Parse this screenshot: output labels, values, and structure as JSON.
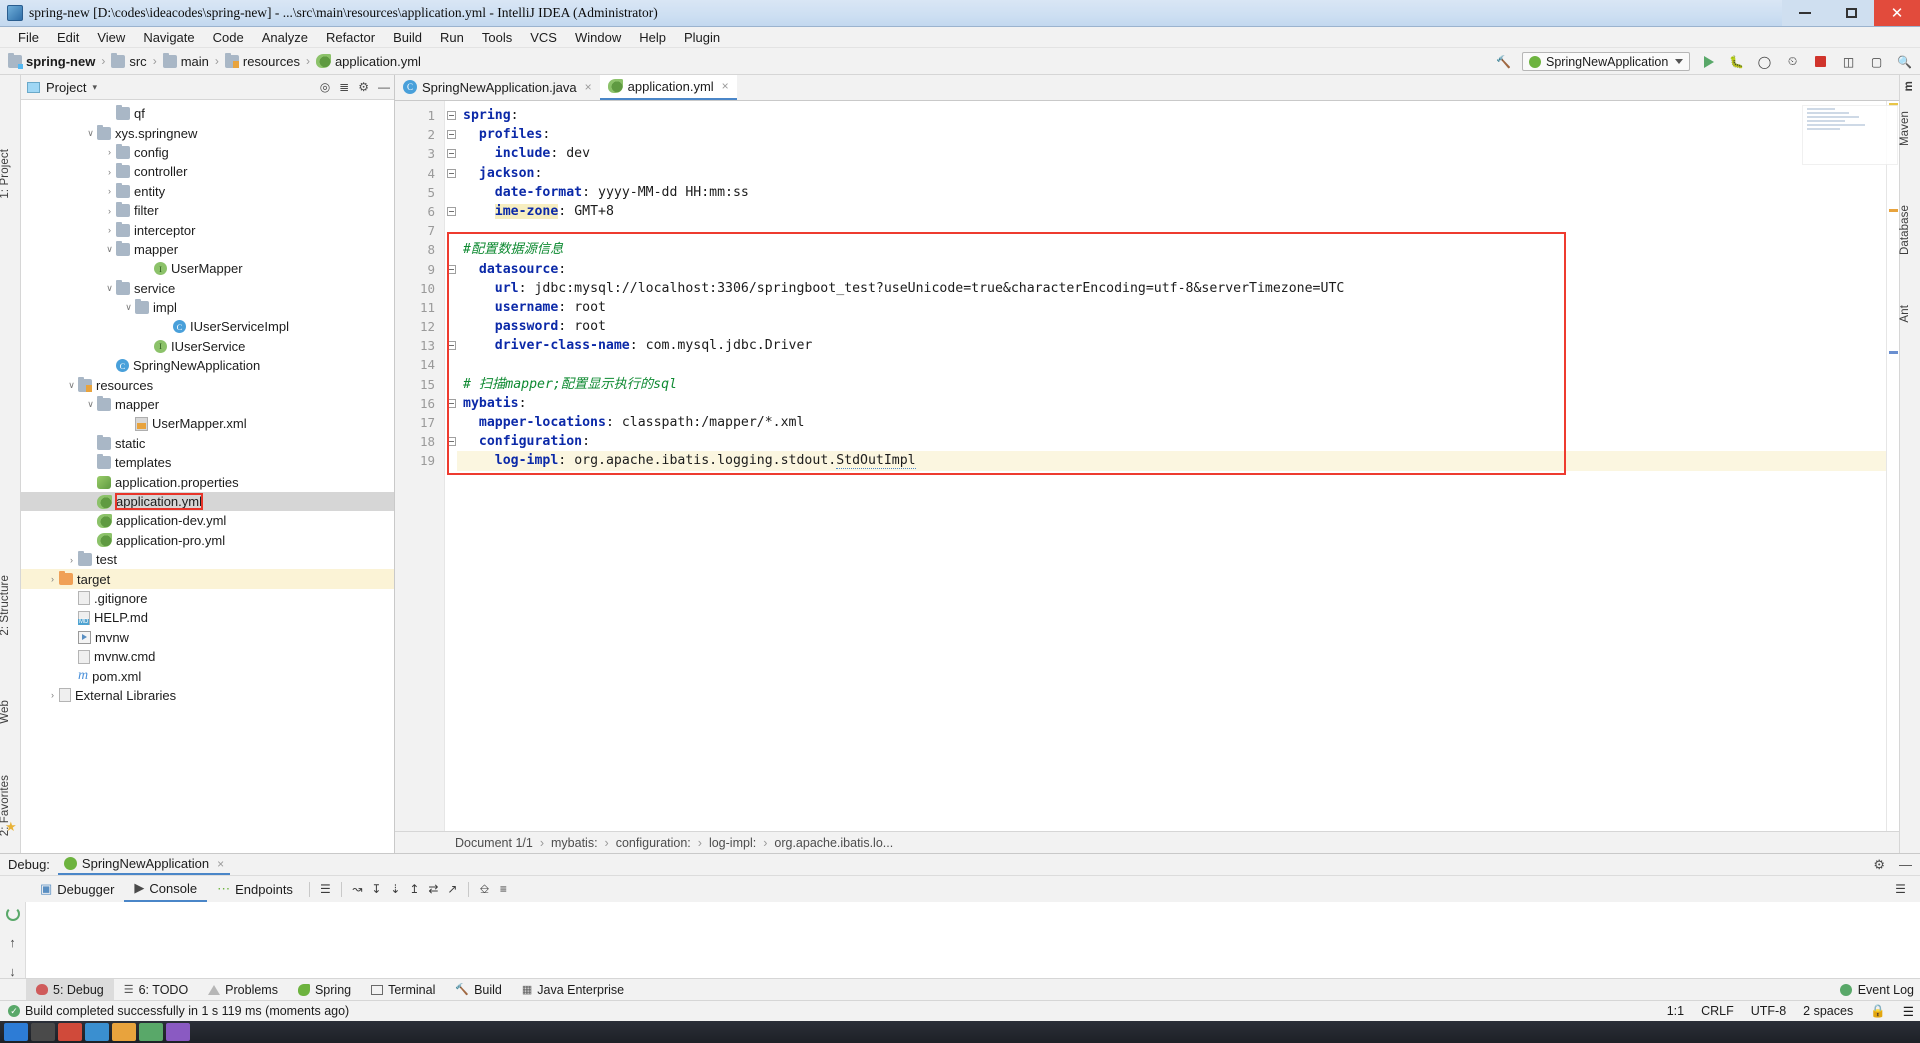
{
  "window": {
    "title": "spring-new [D:\\codes\\ideacodes\\spring-new] - ...\\src\\main\\resources\\application.yml - IntelliJ IDEA (Administrator)",
    "minimize_label": "—",
    "maximize_label": "❐",
    "close_label": "✕"
  },
  "menubar": {
    "items": [
      "File",
      "Edit",
      "View",
      "Navigate",
      "Code",
      "Analyze",
      "Refactor",
      "Build",
      "Run",
      "Tools",
      "VCS",
      "Window",
      "Help",
      "Plugin"
    ]
  },
  "navbar": {
    "breadcrumbs": [
      "spring-new",
      "src",
      "main",
      "resources",
      "application.yml"
    ],
    "separator": "›",
    "run_config": "SpringNewApplication",
    "icons": [
      "hammer-icon",
      "run-icon",
      "debug-icon",
      "coverage-icon",
      "profile-icon",
      "stop-icon",
      "layout-icon",
      "restore-icon",
      "search-icon"
    ]
  },
  "left_strip": {
    "labels": [
      "1: Project",
      "Structure",
      "2: Structure",
      "Web",
      "2: Favorites"
    ]
  },
  "right_strip": {
    "labels": [
      "m",
      "Maven",
      "Database",
      "Ant"
    ]
  },
  "project_panel": {
    "title": "Project",
    "dropdown": "▾",
    "tree": [
      {
        "indent": 4,
        "arrow": "",
        "icon": "folder-icon",
        "label": "qf"
      },
      {
        "indent": 3,
        "arrow": "∨",
        "icon": "folder-icon",
        "label": "xys.springnew"
      },
      {
        "indent": 4,
        "arrow": "›",
        "icon": "folder-icon",
        "label": "config"
      },
      {
        "indent": 4,
        "arrow": "›",
        "icon": "folder-icon",
        "label": "controller"
      },
      {
        "indent": 4,
        "arrow": "›",
        "icon": "folder-icon",
        "label": "entity"
      },
      {
        "indent": 4,
        "arrow": "›",
        "icon": "folder-icon",
        "label": "filter"
      },
      {
        "indent": 4,
        "arrow": "›",
        "icon": "folder-icon",
        "label": "interceptor"
      },
      {
        "indent": 4,
        "arrow": "∨",
        "icon": "folder-icon",
        "label": "mapper"
      },
      {
        "indent": 6,
        "arrow": "",
        "icon": "interface-icon",
        "label": "UserMapper"
      },
      {
        "indent": 4,
        "arrow": "∨",
        "icon": "folder-icon",
        "label": "service"
      },
      {
        "indent": 5,
        "arrow": "∨",
        "icon": "folder-icon",
        "label": "impl"
      },
      {
        "indent": 7,
        "arrow": "",
        "icon": "class-icon",
        "label": "IUserServiceImpl"
      },
      {
        "indent": 6,
        "arrow": "",
        "icon": "interface-icon",
        "label": "IUserService"
      },
      {
        "indent": 4,
        "arrow": "",
        "icon": "class-icon",
        "label": "SpringNewApplication"
      },
      {
        "indent": 2,
        "arrow": "∨",
        "icon": "resources-folder-icon",
        "label": "resources"
      },
      {
        "indent": 3,
        "arrow": "∨",
        "icon": "folder-icon",
        "label": "mapper"
      },
      {
        "indent": 5,
        "arrow": "",
        "icon": "xml-file-icon",
        "label": "UserMapper.xml"
      },
      {
        "indent": 3,
        "arrow": "",
        "icon": "folder-icon",
        "label": "static"
      },
      {
        "indent": 3,
        "arrow": "",
        "icon": "folder-icon",
        "label": "templates"
      },
      {
        "indent": 3,
        "arrow": "",
        "icon": "properties-file-icon",
        "label": "application.properties"
      },
      {
        "indent": 3,
        "arrow": "",
        "icon": "yml-file-icon",
        "label": "application.yml",
        "selected": true,
        "boxed": true
      },
      {
        "indent": 3,
        "arrow": "",
        "icon": "yml-file-icon",
        "label": "application-dev.yml"
      },
      {
        "indent": 3,
        "arrow": "",
        "icon": "yml-file-icon",
        "label": "application-pro.yml"
      },
      {
        "indent": 2,
        "arrow": "›",
        "icon": "folder-icon",
        "label": "test"
      },
      {
        "indent": 1,
        "arrow": "›",
        "icon": "target-folder-icon",
        "label": "target",
        "highlighted": true
      },
      {
        "indent": 2,
        "arrow": "",
        "icon": "gitignore-file-icon",
        "label": ".gitignore"
      },
      {
        "indent": 2,
        "arrow": "",
        "icon": "markdown-file-icon",
        "label": "HELP.md"
      },
      {
        "indent": 2,
        "arrow": "",
        "icon": "script-file-icon",
        "label": "mvnw"
      },
      {
        "indent": 2,
        "arrow": "",
        "icon": "file-icon",
        "label": "mvnw.cmd"
      },
      {
        "indent": 2,
        "arrow": "",
        "icon": "maven-file-icon",
        "label": "pom.xml"
      },
      {
        "indent": 1,
        "arrow": "›",
        "icon": "library-icon",
        "label": "External Libraries"
      }
    ]
  },
  "editor": {
    "tabs": [
      {
        "label": "SpringNewApplication.java",
        "icon": "java-class-icon",
        "active": false,
        "close": "×"
      },
      {
        "label": "application.yml",
        "icon": "yml-file-icon",
        "active": true,
        "close": "×"
      }
    ],
    "line_numbers": [
      1,
      2,
      3,
      4,
      5,
      6,
      7,
      8,
      9,
      10,
      11,
      12,
      13,
      14,
      15,
      16,
      17,
      18,
      19
    ],
    "lines": [
      {
        "n": 1,
        "indent": 0,
        "key": "spring",
        "sep": ":",
        "value": "",
        "fold": true
      },
      {
        "n": 2,
        "indent": 1,
        "key": "profiles",
        "sep": ":",
        "value": "",
        "fold": true
      },
      {
        "n": 3,
        "indent": 2,
        "key": "include",
        "sep": ":",
        "value": "dev",
        "fold": true
      },
      {
        "n": 4,
        "indent": 1,
        "key": "jackson",
        "sep": ":",
        "value": "",
        "fold": true
      },
      {
        "n": 5,
        "indent": 2,
        "key": "date-format",
        "sep": ":",
        "value": "yyyy-MM-dd HH:mm:ss"
      },
      {
        "n": 6,
        "indent": 2,
        "key": "ime-zone",
        "sep": ":",
        "value": "GMT+8",
        "fold": true,
        "key_highlight": true
      },
      {
        "n": 7,
        "indent": 0,
        "key": "",
        "sep": "",
        "value": ""
      },
      {
        "n": 8,
        "indent": 0,
        "comment": "#配置数据源信息"
      },
      {
        "n": 9,
        "indent": 1,
        "key": "datasource",
        "sep": ":",
        "value": "",
        "fold": true
      },
      {
        "n": 10,
        "indent": 2,
        "key": "url",
        "sep": ":",
        "value": "jdbc:mysql://localhost:3306/springboot_test?useUnicode=true&characterEncoding=utf-8&serverTimezone=UTC"
      },
      {
        "n": 11,
        "indent": 2,
        "key": "username",
        "sep": ":",
        "value": "root"
      },
      {
        "n": 12,
        "indent": 2,
        "key": "password",
        "sep": ":",
        "value": "root"
      },
      {
        "n": 13,
        "indent": 2,
        "key": "driver-class-name",
        "sep": ":",
        "value": "com.mysql.jdbc.Driver",
        "fold": true
      },
      {
        "n": 14,
        "indent": 0,
        "key": "",
        "sep": "",
        "value": ""
      },
      {
        "n": 15,
        "indent": 0,
        "comment": "# 扫描mapper;配置显示执行的sql"
      },
      {
        "n": 16,
        "indent": 0,
        "key": "mybatis",
        "sep": ":",
        "value": "",
        "fold": true
      },
      {
        "n": 17,
        "indent": 1,
        "key": "mapper-locations",
        "sep": ":",
        "value": "classpath:/mapper/*.xml"
      },
      {
        "n": 18,
        "indent": 1,
        "key": "configuration",
        "sep": ":",
        "value": "",
        "fold": true
      },
      {
        "n": 19,
        "indent": 2,
        "key": "log-impl",
        "sep": ":",
        "value": "org.apache.ibatis.logging.stdout.",
        "value_link": "StdOutImpl",
        "caret": true
      }
    ],
    "breadcrumb": [
      "Document 1/1",
      "mybatis:",
      "configuration:",
      "log-impl:",
      "org.apache.ibatis.lo..."
    ],
    "breadcrumb_separator": "›"
  },
  "debug_panel": {
    "label": "Debug:",
    "session": "SpringNewApplication",
    "session_close": "×",
    "tabs": [
      {
        "label": "Debugger",
        "icon": "debugger-icon",
        "selected": false
      },
      {
        "label": "Console",
        "icon": "console-icon",
        "selected": true
      },
      {
        "label": "Endpoints",
        "icon": "endpoints-icon",
        "selected": false
      }
    ],
    "right_icons": [
      "settings-icon",
      "hide-icon"
    ],
    "toolbar_icons": [
      "rerun-icon",
      "scroll-up-icon",
      "step-over-icon",
      "step-into-icon",
      "step-out-icon",
      "run-to-cursor-icon",
      "evaluate-icon",
      "print-icon",
      "soft-wrap-icon"
    ]
  },
  "bottom_toolwindows": {
    "items": [
      {
        "label": "5: Debug",
        "icon": "bug-icon",
        "selected": true
      },
      {
        "label": "6: TODO",
        "icon": "todo-icon",
        "selected": false
      },
      {
        "label": "Problems",
        "icon": "warning-icon",
        "selected": false
      },
      {
        "label": "Spring",
        "icon": "spring-icon",
        "selected": false
      },
      {
        "label": "Terminal",
        "icon": "terminal-icon",
        "selected": false
      },
      {
        "label": "Build",
        "icon": "hammer-icon",
        "selected": false
      },
      {
        "label": "Java Enterprise",
        "icon": "java-ee-icon",
        "selected": false
      }
    ],
    "event_log": "Event Log"
  },
  "statusbar": {
    "message": "Build completed successfully in 1 s 119 ms (moments ago)",
    "caret": "1:1",
    "line_separator": "CRLF",
    "encoding": "UTF-8",
    "indent": "2 spaces",
    "lock_icon": "lock-icon"
  },
  "colors": {
    "accent": "#4a86c8",
    "keyword": "#0b29a8",
    "comment": "#0f8a32",
    "red_box": "#ee3b2f",
    "selection": "#d6d6d6",
    "highlight": "#fbf3d6",
    "green": "#59a869",
    "stop_red": "#d0342c"
  }
}
